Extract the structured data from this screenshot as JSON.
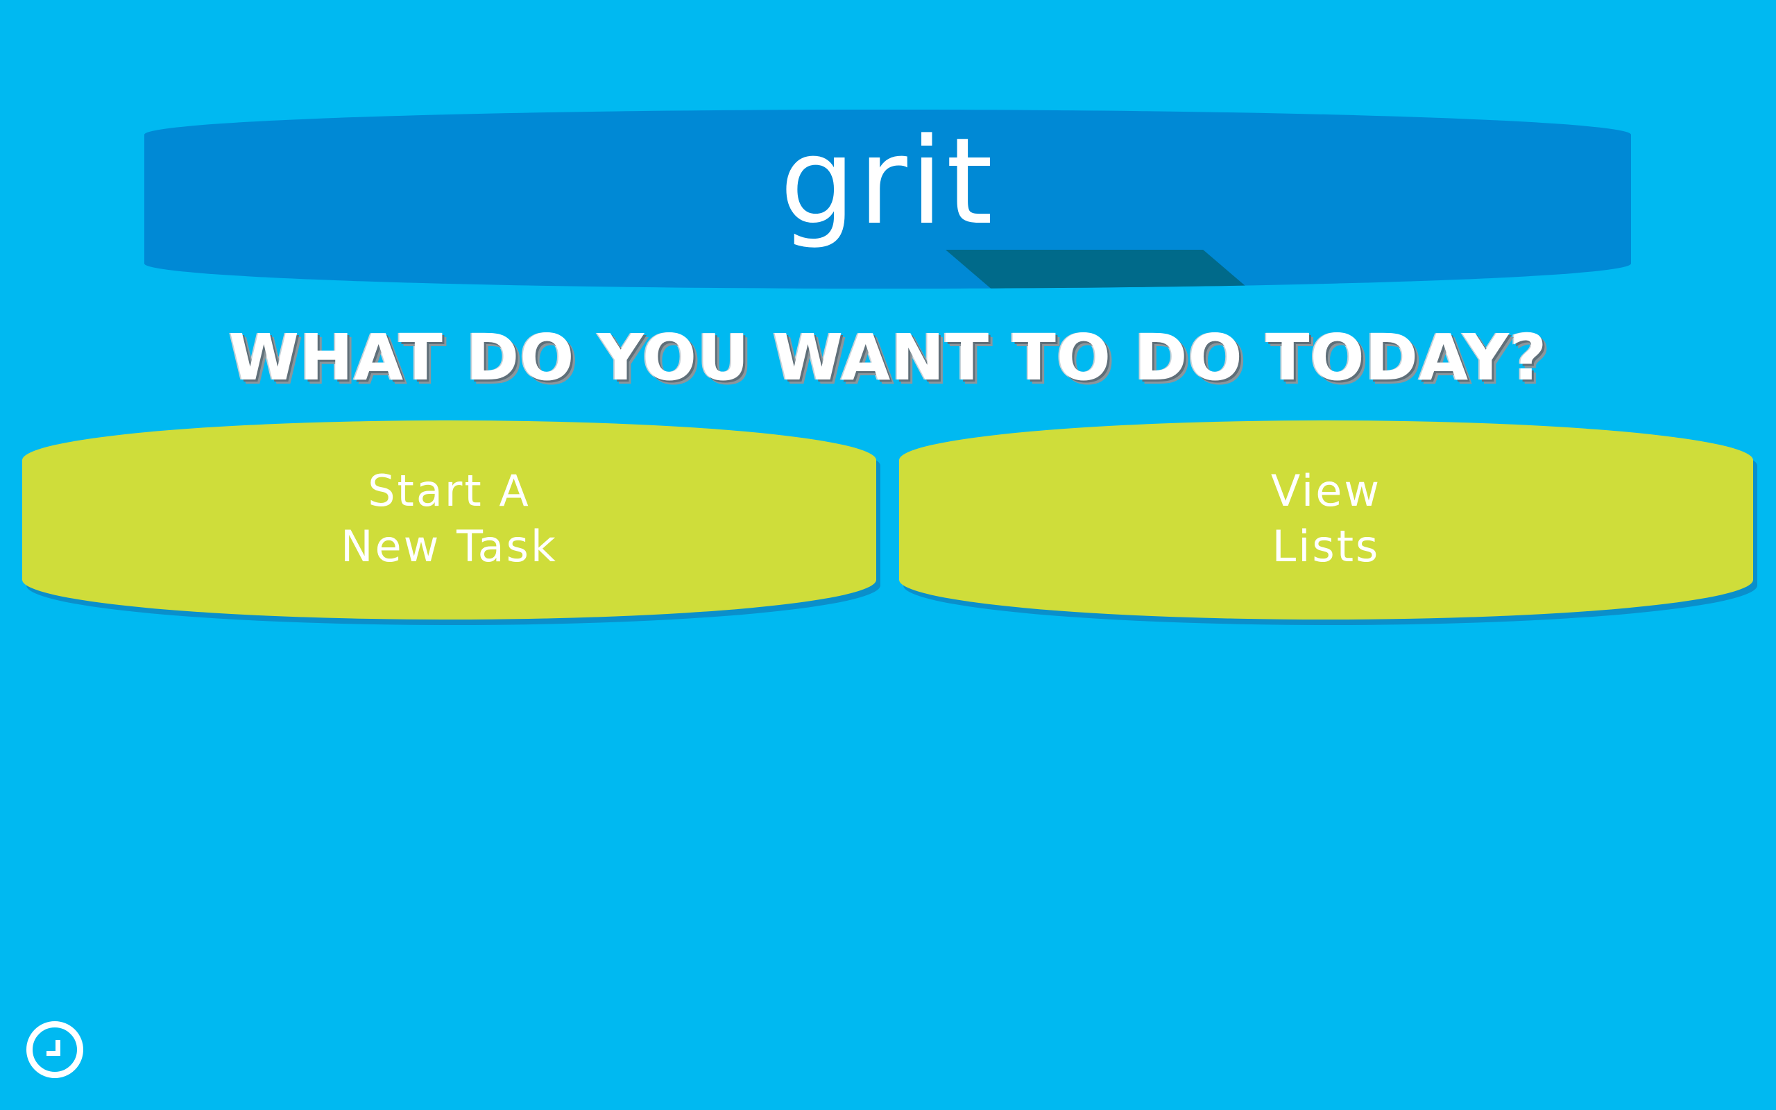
{
  "app": {
    "logo": "grit"
  },
  "prompt": {
    "question": "WHAT DO YOU WANT TO DO TODAY?"
  },
  "actions": [
    {
      "line1": "Start A",
      "line2": "New Task"
    },
    {
      "line1": "View",
      "line2": "Lists"
    }
  ],
  "footer": {
    "icon": "clock-icon"
  },
  "colors": {
    "background": "#00b9f1",
    "header": "#0089d5",
    "header_shadow": "#006a8a",
    "button": "#cfdd3a",
    "text": "#ffffff"
  }
}
